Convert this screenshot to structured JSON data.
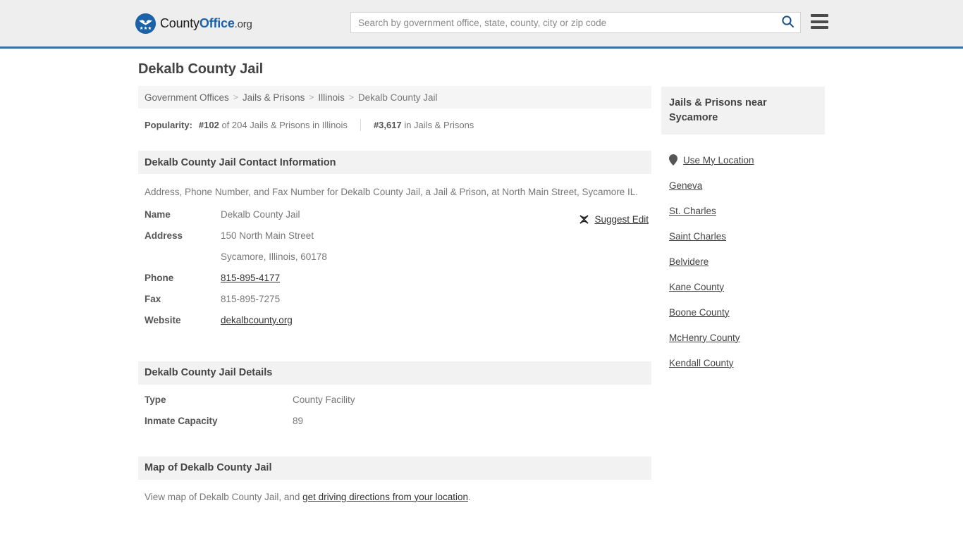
{
  "header": {
    "logo": {
      "part1": "County",
      "part2": "Office",
      "part3": ".org",
      "icon": "eagle-stars-icon"
    },
    "search": {
      "placeholder": "Search by government office, state, county, city or zip code",
      "value": "",
      "search_icon": "search-icon"
    },
    "menu_icon": "hamburger-menu-icon",
    "accent_color": "#3b6ea5"
  },
  "main": {
    "title": "Dekalb County Jail",
    "breadcrumb": [
      "Government Offices",
      "Jails & Prisons",
      "Illinois",
      "Dekalb County Jail"
    ],
    "breadcrumb_separator": ">",
    "popularity": {
      "label": "Popularity:",
      "state_rank": "#102",
      "state_text": "of 204 Jails & Prisons in Illinois",
      "national_rank": "#3,617",
      "national_text": "in Jails & Prisons"
    },
    "contact": {
      "heading": "Dekalb County Jail Contact Information",
      "description": "Address, Phone Number, and Fax Number for Dekalb County Jail, a Jail & Prison, at North Main Street, Sycamore IL.",
      "suggest_edit": {
        "label": "Suggest Edit",
        "icon": "suggest-edit-icon"
      },
      "rows": [
        {
          "label": "Name",
          "value": "Dekalb County Jail",
          "link": false
        },
        {
          "label": "Address",
          "value": "150 North Main Street",
          "link": false
        },
        {
          "label": "",
          "value": "Sycamore, Illinois, 60178",
          "link": false
        },
        {
          "label": "Phone",
          "value": "815-895-4177",
          "link": true
        },
        {
          "label": "Fax",
          "value": "815-895-7275",
          "link": false
        },
        {
          "label": "Website",
          "value": "dekalbcounty.org",
          "link": true
        }
      ]
    },
    "details": {
      "heading": "Dekalb County Jail Details",
      "rows": [
        {
          "label": "Type",
          "value": "County Facility"
        },
        {
          "label": "Inmate Capacity",
          "value": "89"
        }
      ]
    },
    "map": {
      "heading": "Map of Dekalb County Jail",
      "text_before": "View map of Dekalb County Jail, and ",
      "link_text": "get driving directions from your location",
      "text_after": "."
    }
  },
  "sidebar": {
    "heading": "Jails & Prisons near Sycamore",
    "use_my_location": {
      "label": "Use My Location",
      "icon": "map-pin-icon"
    },
    "items": [
      {
        "label": "Geneva"
      },
      {
        "label": "St. Charles"
      },
      {
        "label": "Saint Charles"
      },
      {
        "label": "Belvidere"
      },
      {
        "label": "Kane County"
      },
      {
        "label": "Boone County"
      },
      {
        "label": "McHenry County"
      },
      {
        "label": "Kendall County"
      }
    ]
  }
}
